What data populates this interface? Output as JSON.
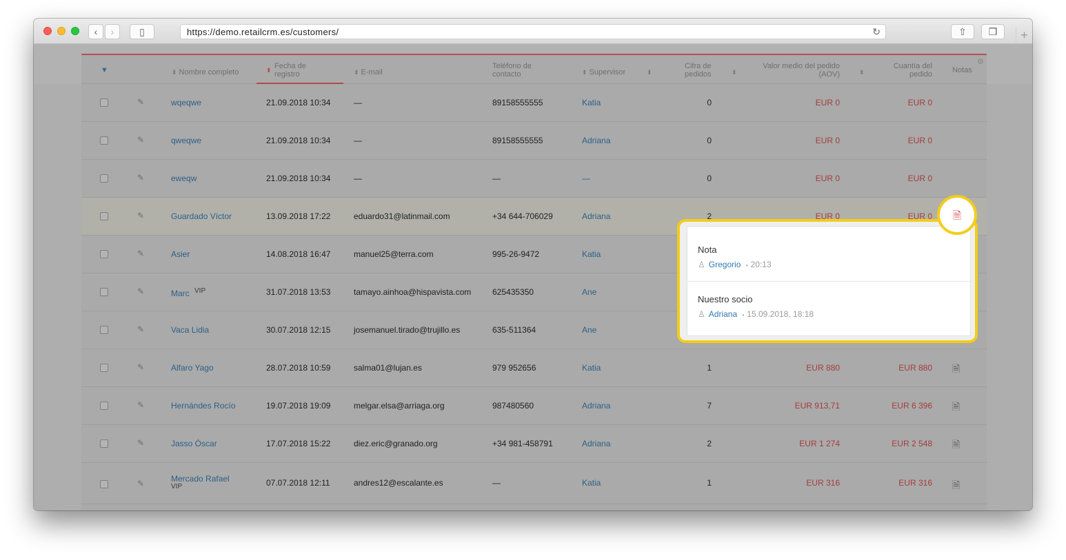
{
  "browser": {
    "url": "https://demo.retailcrm.es/customers/",
    "back_glyph": "‹",
    "forward_glyph": "›",
    "reload_glyph": "↻",
    "newtab_glyph": "+",
    "sidebar_glyph": "▯",
    "share_glyph": "⇧",
    "tabs_glyph": "❐"
  },
  "table": {
    "headers": {
      "select_all": "▼",
      "name": "Nombre completo",
      "date_l1": "Fecha de",
      "date_l2": "registro",
      "email": "E-mail",
      "phone_l1": "Teléfono de",
      "phone_l2": "contacto",
      "supervisor": "Supervisor",
      "orders_l1": "Cifra de",
      "orders_l2": "pedidos",
      "aov_l1": "Valor medio del pedido",
      "aov_l2": "(AOV)",
      "total_l1": "Cuantía del",
      "total_l2": "pedido",
      "notes": "Notas",
      "sort_glyph": "⬍",
      "sort_active_glyph": "⬍",
      "gear_glyph": "⚙"
    },
    "rows": [
      {
        "name": "wqeqwe",
        "vip": "",
        "date": "21.09.2018 10:34",
        "email": "—",
        "phone": "89158555555",
        "supervisor": "Katia",
        "orders": "0",
        "aov": "EUR 0",
        "total": "EUR 0",
        "note": ""
      },
      {
        "name": "qweqwe",
        "vip": "",
        "date": "21.09.2018 10:34",
        "email": "—",
        "phone": "89158555555",
        "supervisor": "Adriana",
        "orders": "0",
        "aov": "EUR 0",
        "total": "EUR 0",
        "note": ""
      },
      {
        "name": "eweqw",
        "vip": "",
        "date": "21.09.2018 10:34",
        "email": "—",
        "phone": "—",
        "supervisor": "—",
        "orders": "0",
        "aov": "EUR 0",
        "total": "EUR 0",
        "note": ""
      },
      {
        "name": "Guardado Víctor",
        "vip": "",
        "date": "13.09.2018 17:22",
        "email": "eduardo31@latinmail.com",
        "phone": "+34 644-706029",
        "supervisor": "Adriana",
        "orders": "2",
        "aov": "EUR 0",
        "total": "EUR 0",
        "note": ""
      },
      {
        "name": "Asier",
        "vip": "",
        "date": "14.08.2018 16:47",
        "email": "manuel25@terra.com",
        "phone": "995-26-9472",
        "supervisor": "Katia",
        "orders": "",
        "aov": "",
        "total": "",
        "note": ""
      },
      {
        "name": "Marc",
        "vip": "VIP",
        "date": "31.07.2018 13:53",
        "email": "tamayo.ainhoa@hispavista.com",
        "phone": "625435350",
        "supervisor": "Ane",
        "orders": "",
        "aov": "",
        "total": "",
        "note": ""
      },
      {
        "name": "Vaca Lidia",
        "vip": "",
        "date": "30.07.2018 12:15",
        "email": "josemanuel.tirado@trujillo.es",
        "phone": "635-511364",
        "supervisor": "Ane",
        "orders": "",
        "aov": "",
        "total": "",
        "note": ""
      },
      {
        "name": "Alfaro Yago",
        "vip": "",
        "date": "28.07.2018 10:59",
        "email": "salma01@lujan.es",
        "phone": "979 952656",
        "supervisor": "Katia",
        "orders": "1",
        "aov": "EUR 880",
        "total": "EUR 880",
        "note": "🗎"
      },
      {
        "name": "Hernándes Rocío",
        "vip": "",
        "date": "19.07.2018 19:09",
        "email": "melgar.elsa@arriaga.org",
        "phone": "987480560",
        "supervisor": "Adriana",
        "orders": "7",
        "aov": "EUR 913,71",
        "total": "EUR 6 396",
        "note": "🗎"
      },
      {
        "name": "Jasso Óscar",
        "vip": "",
        "date": "17.07.2018 15:22",
        "email": "diez.eric@granado.org",
        "phone": "+34 981-458791",
        "supervisor": "Adriana",
        "orders": "2",
        "aov": "EUR 1 274",
        "total": "EUR 2 548",
        "note": "🗎"
      },
      {
        "name": "Mercado Rafael",
        "vip": "VIP",
        "date": "07.07.2018 12:11",
        "email": "andres12@escalante.es",
        "phone": "—",
        "supervisor": "Katia",
        "orders": "1",
        "aov": "EUR 316",
        "total": "EUR 316",
        "note": "🗎"
      }
    ],
    "edit_glyph": "✎"
  },
  "popup": {
    "trigger_glyph": "🗎",
    "user_glyph": "♙",
    "separator": "•",
    "notes": [
      {
        "title": "Nota",
        "user": "Gregorio",
        "time": "20:13"
      },
      {
        "title": "Nuestro socio",
        "user": "Adriana",
        "time": "15.09.2018, 18:18"
      }
    ]
  }
}
